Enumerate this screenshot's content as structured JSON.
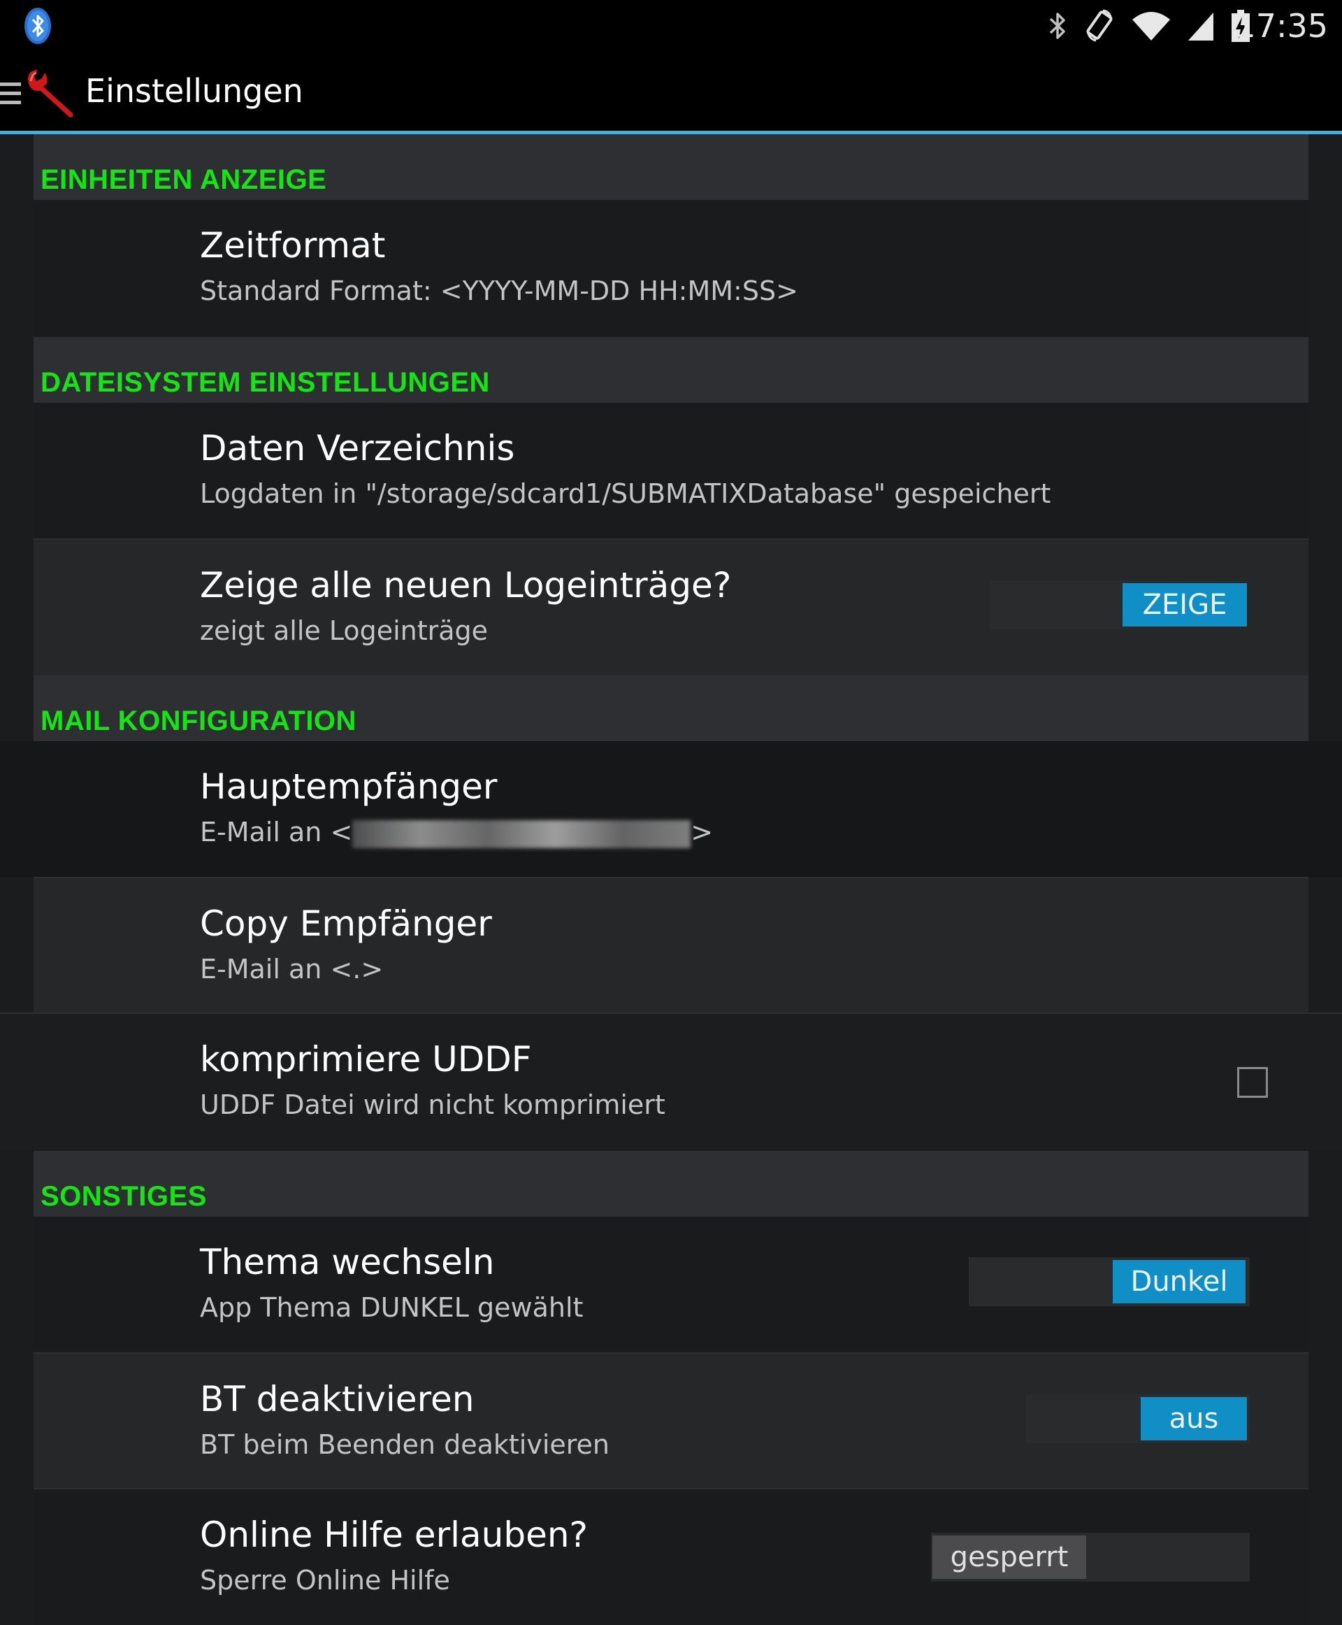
{
  "statusbar": {
    "time": "17:35",
    "icons": [
      "bluetooth-app-icon",
      "bluetooth-icon",
      "screen-rotation-icon",
      "wifi-icon",
      "cell-signal-icon",
      "battery-charging-icon"
    ]
  },
  "actionbar": {
    "title": "Einstellungen",
    "icons": [
      "drawer-menu-icon",
      "wrench-app-icon"
    ]
  },
  "sections": {
    "einheiten": {
      "header": "EINHEITEN ANZEIGE"
    },
    "dateisystem": {
      "header": "DATEISYSTEM EINSTELLUNGEN"
    },
    "mail": {
      "header": "MAIL KONFIGURATION"
    },
    "sonstiges": {
      "header": "SONSTIGES"
    }
  },
  "prefs": {
    "zeitformat": {
      "title": "Zeitformat",
      "summary": "Standard Format: <YYYY-MM-DD HH:MM:SS>"
    },
    "daten_verzeichnis": {
      "title": "Daten Verzeichnis",
      "summary": "Logdaten in \"/storage/sdcard1/SUBMATIXDatabase\" gespeichert"
    },
    "zeige_logs": {
      "title": "Zeige alle neuen Logeinträge?",
      "summary": "zeigt alle Logeinträge",
      "switch_label": "ZEIGE",
      "switch_on": true
    },
    "hauptempfaenger": {
      "title": "Hauptempfänger",
      "summary_prefix": "E-Mail an <",
      "summary_suffix": ">"
    },
    "copy_empfaenger": {
      "title": "Copy Empfänger",
      "summary": "E-Mail an <.>"
    },
    "komprimiere_uddf": {
      "title": "komprimiere UDDF",
      "summary": "UDDF Datei wird nicht komprimiert",
      "checked": false
    },
    "thema": {
      "title": "Thema wechseln",
      "summary": "App Thema DUNKEL gewählt",
      "switch_label": "Dunkel",
      "switch_on": true
    },
    "bt_deaktivieren": {
      "title": "BT deaktivieren",
      "summary": "BT beim Beenden deaktivieren",
      "switch_label": "aus",
      "switch_on": true
    },
    "online_hilfe": {
      "title": "Online Hilfe erlauben?",
      "summary": "Sperre Online Hilfe",
      "switch_label": "gesperrt",
      "switch_on": false
    }
  },
  "colors": {
    "accent": "#33b5e5",
    "section_header_text": "#14e614",
    "switch_on": "#0f8fc6",
    "switch_off": "#4b4b4d"
  }
}
